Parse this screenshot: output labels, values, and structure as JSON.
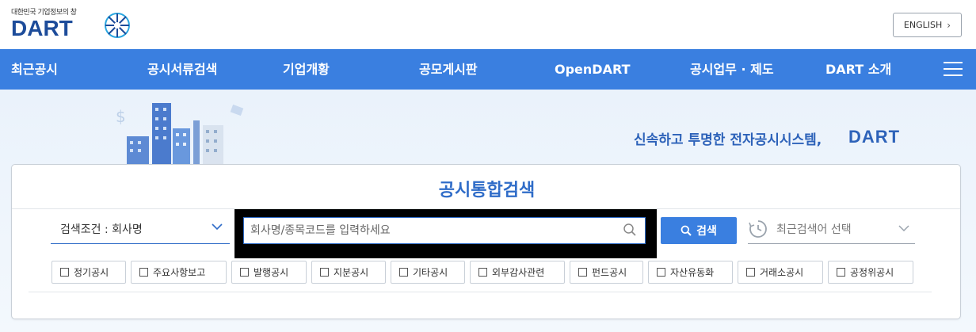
{
  "header": {
    "logo_sub": "대한민국 기업정보의 창",
    "logo_main": "DART",
    "english_label": "ENGLISH",
    "english_chevron": "›"
  },
  "nav": {
    "items": [
      {
        "label": "최근공시"
      },
      {
        "label": "공시서류검색"
      },
      {
        "label": "기업개황"
      },
      {
        "label": "공모게시판"
      },
      {
        "label": "OpenDART"
      },
      {
        "label": "공시업무 · 제도"
      },
      {
        "label": "DART 소개"
      }
    ],
    "menu_icon": "hamburger-icon"
  },
  "hero": {
    "slogan": "신속하고 투명한 전자공시시스템,",
    "slogan_brand": "DART"
  },
  "search": {
    "title": "공시통합검색",
    "condition_label": "검색조건 : 회사명",
    "input_value": "",
    "input_placeholder": "회사명/종목코드를 입력하세요",
    "button_label": "검색",
    "recent_label": "최근검색어 선택",
    "categories": [
      {
        "label": "정기공시",
        "checked": false
      },
      {
        "label": "주요사항보고",
        "checked": false
      },
      {
        "label": "발행공시",
        "checked": false
      },
      {
        "label": "지분공시",
        "checked": false
      },
      {
        "label": "기타공시",
        "checked": false
      },
      {
        "label": "외부감사관련",
        "checked": false
      },
      {
        "label": "펀드공시",
        "checked": false
      },
      {
        "label": "자산유동화",
        "checked": false
      },
      {
        "label": "거래소공시",
        "checked": false
      },
      {
        "label": "공정위공시",
        "checked": false
      }
    ]
  },
  "colors": {
    "brand_blue": "#3a7fe0",
    "title_blue": "#2f6cc8",
    "logo_navy": "#1d4c9a"
  }
}
